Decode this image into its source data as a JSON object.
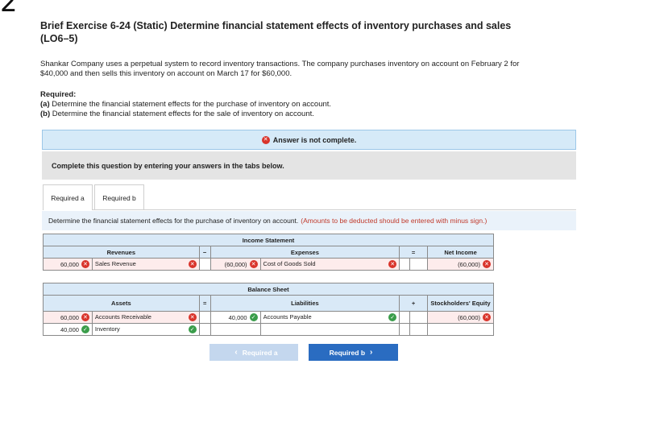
{
  "question_number": "2",
  "title": "Brief Exercise 6-24 (Static) Determine financial statement effects of inventory purchases and sales (LO6–5)",
  "intro": "Shankar Company uses a perpetual system to record inventory transactions. The company purchases inventory on account on February 2 for $40,000 and then sells this inventory on account on March 17 for $60,000.",
  "required": {
    "heading": "Required:",
    "a_tag": "(a)",
    "a_text": "Determine the financial statement effects for the purchase of inventory on account.",
    "b_tag": "(b)",
    "b_text": "Determine the financial statement effects for the sale of inventory on account."
  },
  "banner": {
    "text": "Answer is not complete."
  },
  "instructions_box": "Complete this question by entering your answers in the tabs below.",
  "tabs": [
    {
      "label": "Required a"
    },
    {
      "label": "Required b"
    }
  ],
  "task": {
    "text": "Determine the financial statement effects for the purchase of inventory on account.",
    "note": "(Amounts to be deducted should be entered with minus sign.)"
  },
  "income_statement": {
    "header": "Income Statement",
    "revenues_header": "Revenues",
    "minus_op": "−",
    "expenses_header": "Expenses",
    "equals_op": "=",
    "net_income_header": "Net Income",
    "row": {
      "revenue_value": "60,000",
      "revenue_account": "Sales Revenue",
      "expense_value": "(60,000)",
      "expense_account": "Cost of Goods Sold",
      "net_income_value": "(60,000)"
    }
  },
  "balance_sheet": {
    "header": "Balance Sheet",
    "assets_header": "Assets",
    "equals_op": "=",
    "liabilities_header": "Liabilities",
    "plus_op": "+",
    "equity_header": "Stockholders' Equity",
    "rows": [
      {
        "asset_value": "60,000",
        "asset_account": "Accounts Receivable",
        "liability_value": "40,000",
        "liability_account": "Accounts Payable",
        "equity_value": "(60,000)"
      },
      {
        "asset_value": "40,000",
        "asset_account": "Inventory",
        "liability_value": "",
        "liability_account": "",
        "equity_value": ""
      }
    ]
  },
  "nav": {
    "prev_label": "Required a",
    "next_label": "Required b"
  },
  "colors": {
    "error": "#d9342b",
    "correct": "#3a9d4a",
    "primary": "#2a6cc1",
    "header_bg": "#d9e9f7"
  },
  "icons": {
    "error": "x-circle-icon",
    "correct": "check-circle-icon"
  }
}
